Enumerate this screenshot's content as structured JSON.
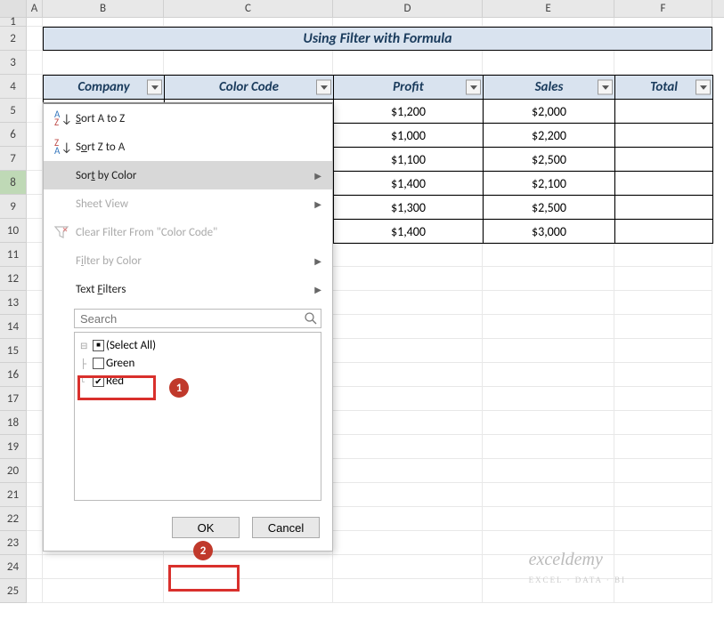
{
  "columns": [
    "A",
    "B",
    "C",
    "D",
    "E",
    "F"
  ],
  "title": "Using Filter with Formula",
  "headers": {
    "company": "Company",
    "color_code": "Color Code",
    "profit": "Profit",
    "sales": "Sales",
    "total": "Total"
  },
  "rows": [
    {
      "profit": "$1,200",
      "sales": "$2,000",
      "total": ""
    },
    {
      "profit": "$1,000",
      "sales": "$2,200",
      "total": ""
    },
    {
      "profit": "$1,100",
      "sales": "$2,500",
      "total": ""
    },
    {
      "profit": "$1,400",
      "sales": "$2,100",
      "total": ""
    },
    {
      "profit": "$1,300",
      "sales": "$2,500",
      "total": ""
    },
    {
      "profit": "$1,400",
      "sales": "$3,000",
      "total": ""
    }
  ],
  "menu": {
    "sort_az": "Sort A to Z",
    "sort_za": "Sort Z to A",
    "sort_color": "Sort by Color",
    "sheet_view": "Sheet View",
    "clear_filter": "Clear Filter From \"Color Code\"",
    "filter_color": "Filter by Color",
    "text_filters": "Text Filters",
    "search_placeholder": "Search",
    "select_all": "(Select All)",
    "green": "Green",
    "red": "Red",
    "ok": "OK",
    "cancel": "Cancel"
  },
  "callouts": {
    "c1": "1",
    "c2": "2"
  },
  "watermark": {
    "brand": "exceldemy",
    "tagline": "EXCEL · DATA · BI"
  },
  "row_numbers": [
    "1",
    "2",
    "3",
    "4",
    "5",
    "6",
    "7",
    "8",
    "9",
    "10",
    "11",
    "12",
    "13",
    "14",
    "15",
    "16",
    "17",
    "18",
    "19",
    "20",
    "21",
    "22",
    "23",
    "24",
    "25"
  ]
}
